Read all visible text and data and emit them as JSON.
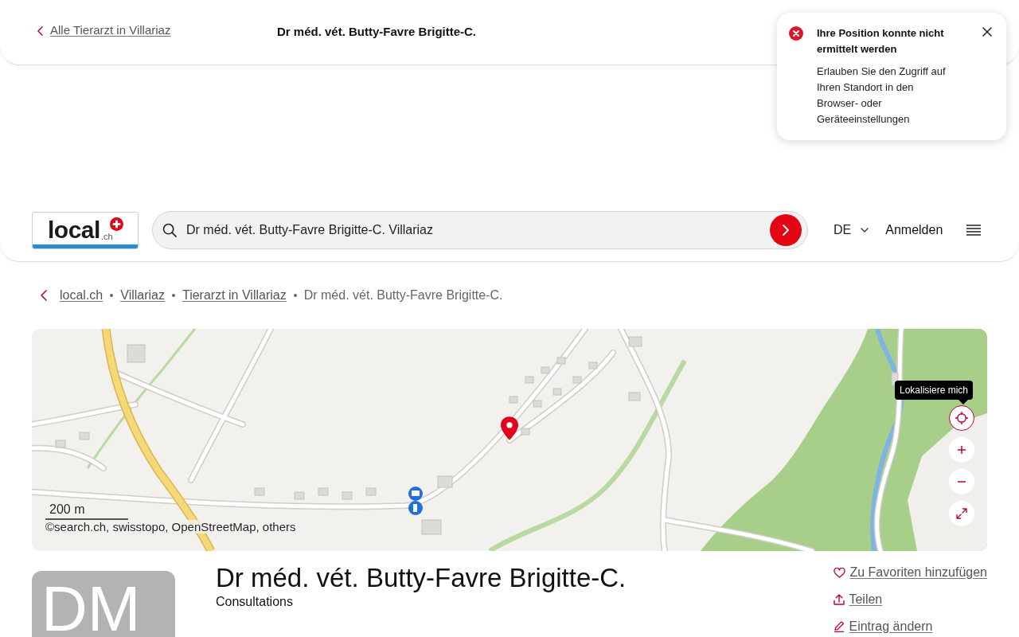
{
  "top_bar": {
    "back_link": "Alle Tierarzt in Villariaz",
    "title": "Dr méd. vét. Butty-Favre Brigitte-C."
  },
  "notification": {
    "kind": "error",
    "title": "Ihre Position konnte nicht ermittelt werden",
    "message": "Erlauben Sie den Zugriff auf Ihren Standort in den Browser- oder Geräteeinstellungen"
  },
  "header": {
    "logo": {
      "name": "local",
      "domain": ".ch"
    },
    "search": {
      "value": "Dr méd. vét. Butty-Favre Brigitte-C. Villariaz"
    },
    "language": "DE",
    "login": "Anmelden"
  },
  "breadcrumb": [
    {
      "label": "local.ch",
      "kind": "link"
    },
    {
      "label": "Villariaz",
      "kind": "link"
    },
    {
      "label": "Tierarzt in Villariaz",
      "kind": "link"
    },
    {
      "label": "Dr méd. vét. Butty-Favre Brigitte-C.",
      "kind": "current"
    }
  ],
  "map": {
    "scale": "200 m",
    "attribution": "©search.ch, swisstopo, OpenStreetMap, others",
    "tooltip": "Lokalisiere mich",
    "controls": [
      {
        "kind": "locate",
        "highlighted": true
      },
      {
        "kind": "zoom_in",
        "highlighted": false
      },
      {
        "kind": "zoom_out",
        "highlighted": false
      },
      {
        "kind": "fullscreen",
        "highlighted": false
      }
    ]
  },
  "listing": {
    "initials": "DM",
    "name": "Dr méd. vét. Butty-Favre Brigitte-C.",
    "category": "Consultations",
    "actions": [
      {
        "kind": "favorite",
        "label": "Zu Favoriten hinzufügen"
      },
      {
        "kind": "share",
        "label": "Teilen"
      },
      {
        "kind": "edit",
        "label": "Eintrag ändern"
      }
    ]
  }
}
